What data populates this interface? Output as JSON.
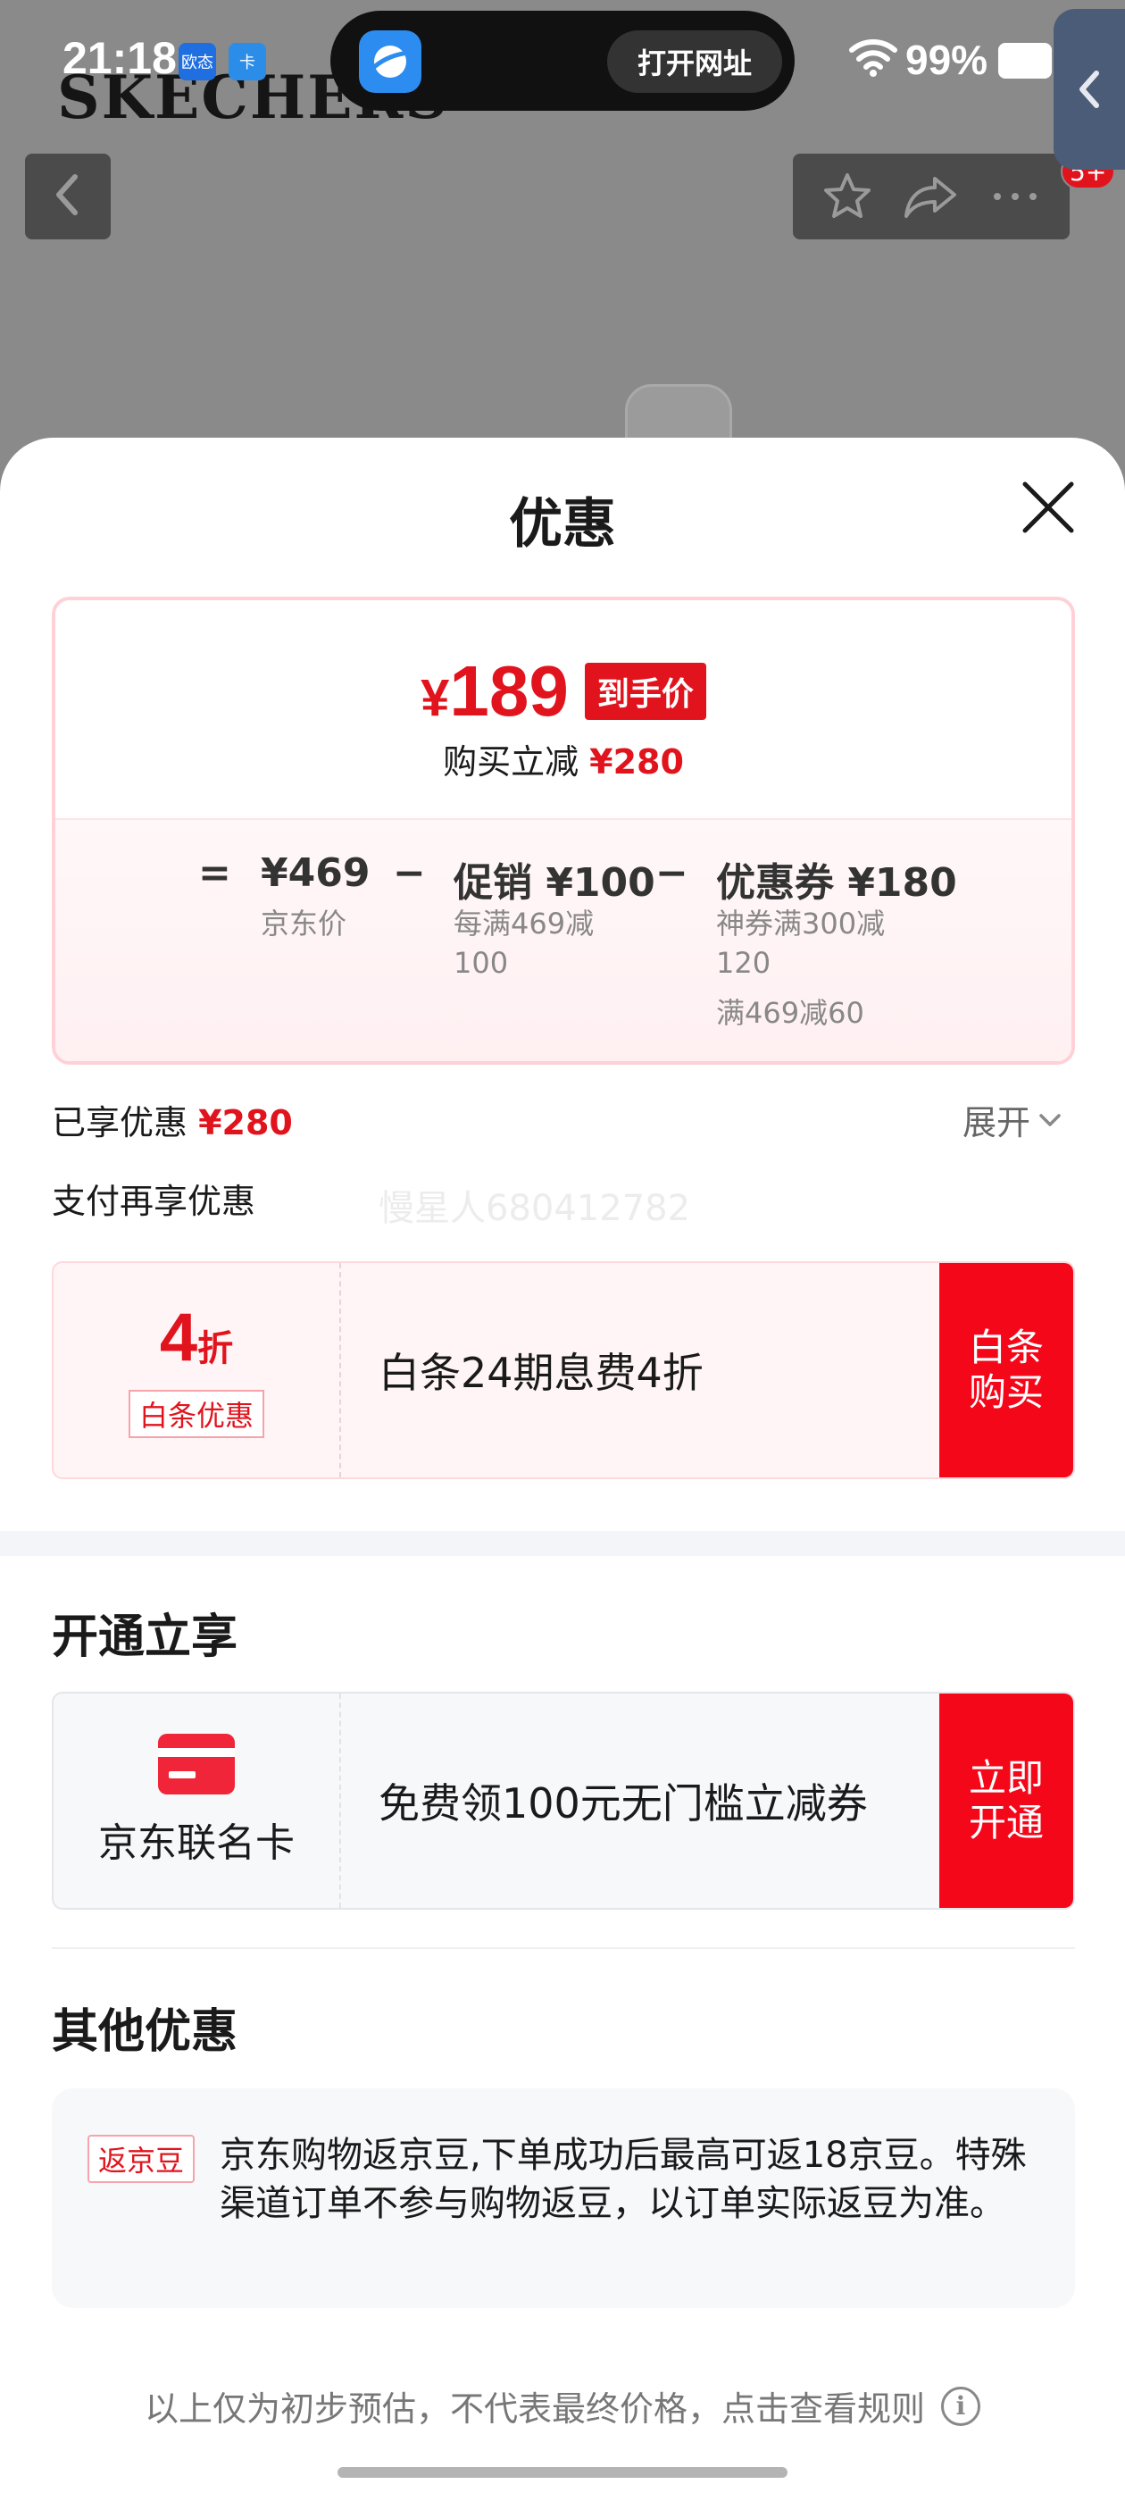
{
  "status_bar": {
    "time": "21:18",
    "app_icons": [
      "欧态",
      "卡"
    ],
    "island_action": "打开网址",
    "battery": "99%"
  },
  "background": {
    "brand": "SKECHERS",
    "notification_count": "5+"
  },
  "icons": {
    "back": "chevron-left-icon",
    "favorite": "star-icon",
    "share": "share-icon",
    "more": "more-icon",
    "close": "close-icon",
    "expand": "chevron-down-icon",
    "card": "credit-card-icon",
    "info": "info-icon"
  },
  "sheet": {
    "title": "优惠",
    "final_price": {
      "currency": "¥",
      "amount": "189",
      "tag": "到手价",
      "saving_label": "购买立减",
      "saving_value": "¥280"
    },
    "breakdown": {
      "eq": "=",
      "minus": "−",
      "jd_price": "¥469",
      "jd_price_label": "京东价",
      "promo": "促销 ¥100",
      "promo_line1": "每满469减",
      "promo_line2": "100",
      "coupon": "优惠券 ¥180",
      "coupon_line1": "神券满300减",
      "coupon_line2": "120",
      "coupon_line3": "满469减60"
    },
    "enjoyed_label": "已享优惠",
    "enjoyed_value": "¥280",
    "expand_label": "展开",
    "pay_more_label": "支付再享优惠",
    "watermark": "慢星人680412782",
    "baitiao_offer": {
      "discount_number": "4",
      "discount_unit": "折",
      "tag": "白条优惠",
      "description": "白条24期息费4折",
      "button_line1": "白条",
      "button_line2": "购买"
    },
    "open_section_title": "开通立享",
    "card_offer": {
      "name": "京东联名卡",
      "description": "免费领100元无门槛立减券",
      "button_line1": "立即",
      "button_line2": "开通"
    },
    "other_section_title": "其他优惠",
    "bean_offer": {
      "tag": "返京豆",
      "text": "京东购物返京豆,下单成功后最高可返18京豆。特殊渠道订单不参与购物返豆，以订单实际返豆为准。"
    },
    "footer_note": "以上仅为初步预估，不代表最终价格，点击查看规则"
  },
  "colors": {
    "accent_red": "#e1141e",
    "button_red": "#f5071a"
  }
}
